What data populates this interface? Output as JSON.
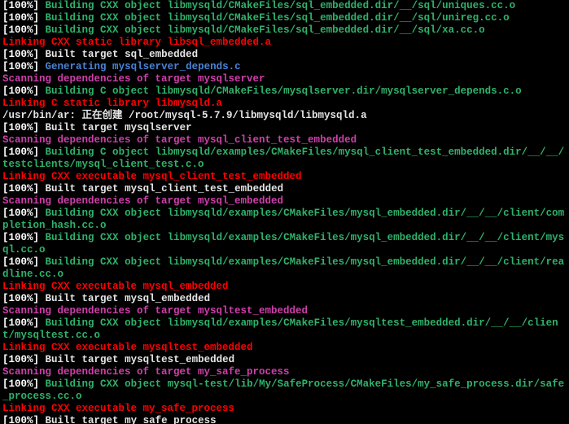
{
  "lines": [
    {
      "id": "l0",
      "prefix": "[100%]",
      "cls": "green",
      "text": " Building CXX object libmysqld/CMakeFiles/sql_embedded.dir/__/sql/uniques.cc.o"
    },
    {
      "id": "l1",
      "prefix": "[100%]",
      "cls": "green",
      "text": " Building CXX object libmysqld/CMakeFiles/sql_embedded.dir/__/sql/unireg.cc.o"
    },
    {
      "id": "l2",
      "prefix": "[100%]",
      "cls": "green",
      "text": " Building CXX object libmysqld/CMakeFiles/sql_embedded.dir/__/sql/xa.cc.o"
    },
    {
      "id": "l3",
      "cls": "red",
      "full": "Linking CXX static library libsql_embedded.a"
    },
    {
      "id": "l4",
      "prefix": "[100%]",
      "cls": "white",
      "text": " Built target sql_embedded"
    },
    {
      "id": "l5",
      "prefix": "[100%]",
      "cls": "blue",
      "text": " Generating mysqlserver_depends.c"
    },
    {
      "id": "l6",
      "cls": "magenta",
      "full": "Scanning dependencies of target mysqlserver"
    },
    {
      "id": "l7",
      "prefix": "[100%]",
      "cls": "green",
      "text": " Building C object libmysqld/CMakeFiles/mysqlserver.dir/mysqlserver_depends.c.o"
    },
    {
      "id": "l8",
      "cls": "red",
      "full": "Linking C static library libmysqld.a"
    },
    {
      "id": "l9",
      "cls": "white",
      "full": "/usr/bin/ar: 正在创建 /root/mysql-5.7.9/libmysqld/libmysqld.a"
    },
    {
      "id": "l10",
      "prefix": "[100%]",
      "cls": "white",
      "text": " Built target mysqlserver"
    },
    {
      "id": "l11",
      "cls": "magenta",
      "full": "Scanning dependencies of target mysql_client_test_embedded"
    },
    {
      "id": "l12",
      "prefix": "[100%]",
      "cls": "green",
      "text": " Building C object libmysqld/examples/CMakeFiles/mysql_client_test_embedded.dir/__/__/testclients/mysql_client_test.c.o"
    },
    {
      "id": "l13",
      "cls": "red",
      "full": "Linking CXX executable mysql_client_test_embedded"
    },
    {
      "id": "l14",
      "prefix": "[100%]",
      "cls": "white",
      "text": " Built target mysql_client_test_embedded"
    },
    {
      "id": "l15",
      "cls": "magenta",
      "full": "Scanning dependencies of target mysql_embedded"
    },
    {
      "id": "l16",
      "prefix": "[100%]",
      "cls": "green",
      "text": " Building CXX object libmysqld/examples/CMakeFiles/mysql_embedded.dir/__/__/client/completion_hash.cc.o"
    },
    {
      "id": "l17",
      "prefix": "[100%]",
      "cls": "green",
      "text": " Building CXX object libmysqld/examples/CMakeFiles/mysql_embedded.dir/__/__/client/mysql.cc.o"
    },
    {
      "id": "l18",
      "prefix": "[100%]",
      "cls": "green",
      "text": " Building CXX object libmysqld/examples/CMakeFiles/mysql_embedded.dir/__/__/client/readline.cc.o"
    },
    {
      "id": "l19",
      "cls": "red",
      "full": "Linking CXX executable mysql_embedded"
    },
    {
      "id": "l20",
      "prefix": "[100%]",
      "cls": "white",
      "text": " Built target mysql_embedded"
    },
    {
      "id": "l21",
      "cls": "magenta",
      "full": "Scanning dependencies of target mysqltest_embedded"
    },
    {
      "id": "l22",
      "prefix": "[100%]",
      "cls": "green",
      "text": " Building CXX object libmysqld/examples/CMakeFiles/mysqltest_embedded.dir/__/__/client/mysqltest.cc.o"
    },
    {
      "id": "l23",
      "cls": "red",
      "full": "Linking CXX executable mysqltest_embedded"
    },
    {
      "id": "l24",
      "prefix": "[100%]",
      "cls": "white",
      "text": " Built target mysqltest_embedded"
    },
    {
      "id": "l25",
      "cls": "magenta",
      "full": "Scanning dependencies of target my_safe_process"
    },
    {
      "id": "l26",
      "prefix": "[100%]",
      "cls": "green",
      "text": " Building CXX object mysql-test/lib/My/SafeProcess/CMakeFiles/my_safe_process.dir/safe_process.cc.o"
    },
    {
      "id": "l27",
      "cls": "red",
      "full": "Linking CXX executable my_safe_process"
    },
    {
      "id": "l28",
      "prefix": "[100%]",
      "cls": "white",
      "text": " Built target my_safe_process"
    }
  ]
}
